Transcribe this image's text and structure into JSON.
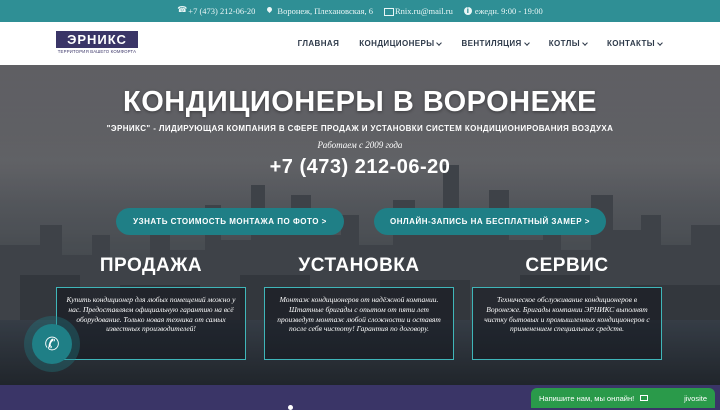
{
  "topbar": {
    "phone": "+7 (473) 212-06-20",
    "address": "Воронеж, Плехановская, 6",
    "email": "Rnix.ru@mail.ru",
    "hours": "ежедн. 9:00 - 19:00"
  },
  "logo": {
    "name": "ЭРНИКС",
    "tagline": "территория вашего комфорта"
  },
  "nav": {
    "items": [
      {
        "label": "ГЛАВНАЯ",
        "has_dropdown": false
      },
      {
        "label": "КОНДИЦИОНЕРЫ",
        "has_dropdown": true
      },
      {
        "label": "ВЕНТИЛЯЦИЯ",
        "has_dropdown": true
      },
      {
        "label": "КОТЛЫ",
        "has_dropdown": true
      },
      {
        "label": "КОНТАКТЫ",
        "has_dropdown": true
      }
    ]
  },
  "hero": {
    "title": "КОНДИЦИОНЕРЫ В ВОРОНЕЖЕ",
    "subtitle": "\"ЭРНИКС\" - ЛИДИРУЮЩАЯ КОМПАНИЯ В СФЕРЕ ПРОДАЖ И УСТАНОВКИ СИСТЕМ КОНДИЦИОНИРОВАНИЯ ВОЗДУХА",
    "since": "Работаем с 2009 года",
    "phone": "+7 (473) 212-06-20",
    "cta_primary": "УЗНАТЬ СТОИМОСТЬ МОНТАЖА ПО ФОТО >",
    "cta_secondary": "ОНЛАЙН-ЗАПИСЬ НА БЕСПЛАТНЫЙ ЗАМЕР >"
  },
  "services": [
    {
      "title": "ПРОДАЖА",
      "text": "Купить кондиционер для любых помещений можно у нас. Предоставляем официальную гарантию на всё оборудование. Только новая техника от самых известных производителей!"
    },
    {
      "title": "УСТАНОВКА",
      "text": "Монтаж кондиционеров от надёжной компании. Штатные бригады с опытом от пяти лет произведут монтаж любой сложности и оставят после себя чистоту! Гарантия по договору."
    },
    {
      "title": "СЕРВИС",
      "text": "Техническое обслуживание кондиционеров в Воронеже. Бригады компании ЭРНИКС выполнят чистку бытовых и промышленных кондиционеров с применением специальных средств."
    }
  ],
  "chat": {
    "label": "Напишите нам, мы онлайн!",
    "brand": "jivosite"
  },
  "icons": {
    "phone": "phone-icon",
    "address": "map-pin-icon",
    "email": "envelope-icon",
    "hours": "info-icon",
    "call": "phone-handset-icon",
    "chat": "envelope-icon"
  },
  "colors": {
    "topbar": "#2f8f95",
    "accent": "#1f7f86",
    "brand": "#3a3567",
    "chat": "#2a9a4a",
    "box_border": "#3fb6b9"
  }
}
